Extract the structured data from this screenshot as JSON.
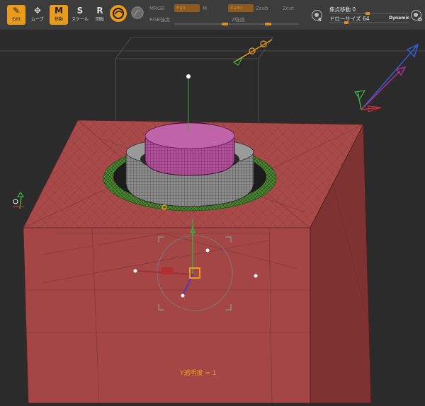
{
  "toolbar": {
    "tools": [
      {
        "name": "edit",
        "label": "Edit",
        "glyph": "✎",
        "active": true
      },
      {
        "name": "move",
        "label": "ムーブ",
        "glyph": "✥",
        "active": false
      },
      {
        "name": "move-mode",
        "label": "移動",
        "glyph": "M",
        "active": true
      },
      {
        "name": "scale",
        "label": "スケール",
        "glyph": "S",
        "active": false
      },
      {
        "name": "rotate",
        "label": "回転",
        "glyph": "R",
        "active": false
      }
    ],
    "mrgb_label": "MRGB",
    "rgb_label": "Rgb",
    "m_label": "M",
    "zadd_label": "Zadd",
    "zsub_label": "Zsub",
    "zcut_label": "Zcut",
    "rgb_intensity_label": "RGB強度",
    "z_intensity_label": "Z強度",
    "focal_shift_label": "焦点移動 0",
    "draw_size_label": "ドローサイズ 64",
    "dynamic_label": "Dynamic",
    "s_letter": "S",
    "d_letter": "D",
    "accent": "#e89b1c"
  },
  "viewport": {
    "opacity_label": "Y透明度 = 1"
  },
  "colors": {
    "mesh_red": "#a84a4a",
    "mesh_pink": "#b0509a",
    "mesh_gray": "#8a8a8a",
    "gizmo_orange": "#e89b1c"
  }
}
